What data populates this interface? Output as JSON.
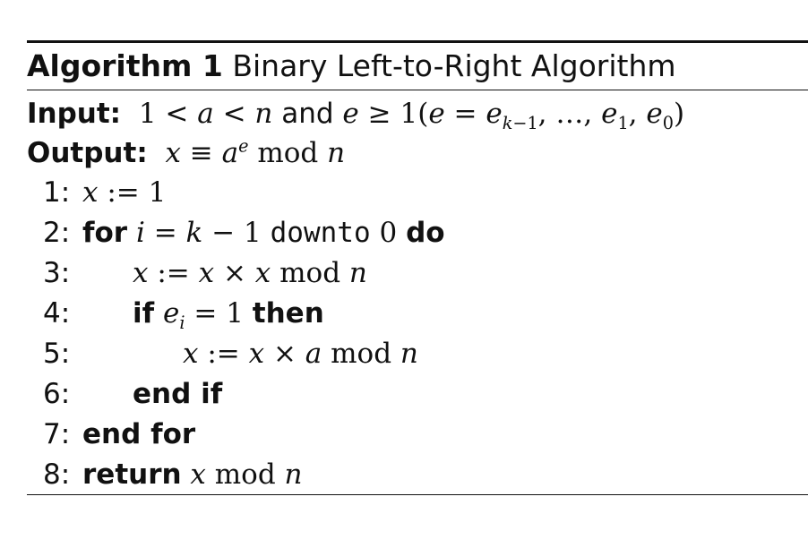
{
  "caption": {
    "label": "Algorithm 1",
    "title": "Binary Left-to-Right Algorithm"
  },
  "input": {
    "label": "Input:",
    "and_word": "and"
  },
  "output": {
    "label": "Output:"
  },
  "lines": [
    {
      "num": "1:"
    },
    {
      "num": "2:",
      "kw_for": "for",
      "kw_downto": "downto",
      "kw_do": "do"
    },
    {
      "num": "3:"
    },
    {
      "num": "4:",
      "kw_if": "if",
      "kw_then": "then"
    },
    {
      "num": "5:"
    },
    {
      "num": "6:",
      "kw_endif": "end if"
    },
    {
      "num": "7:",
      "kw_endfor": "end for"
    },
    {
      "num": "8:",
      "kw_return": "return"
    }
  ],
  "math": {
    "mod": "mod"
  }
}
